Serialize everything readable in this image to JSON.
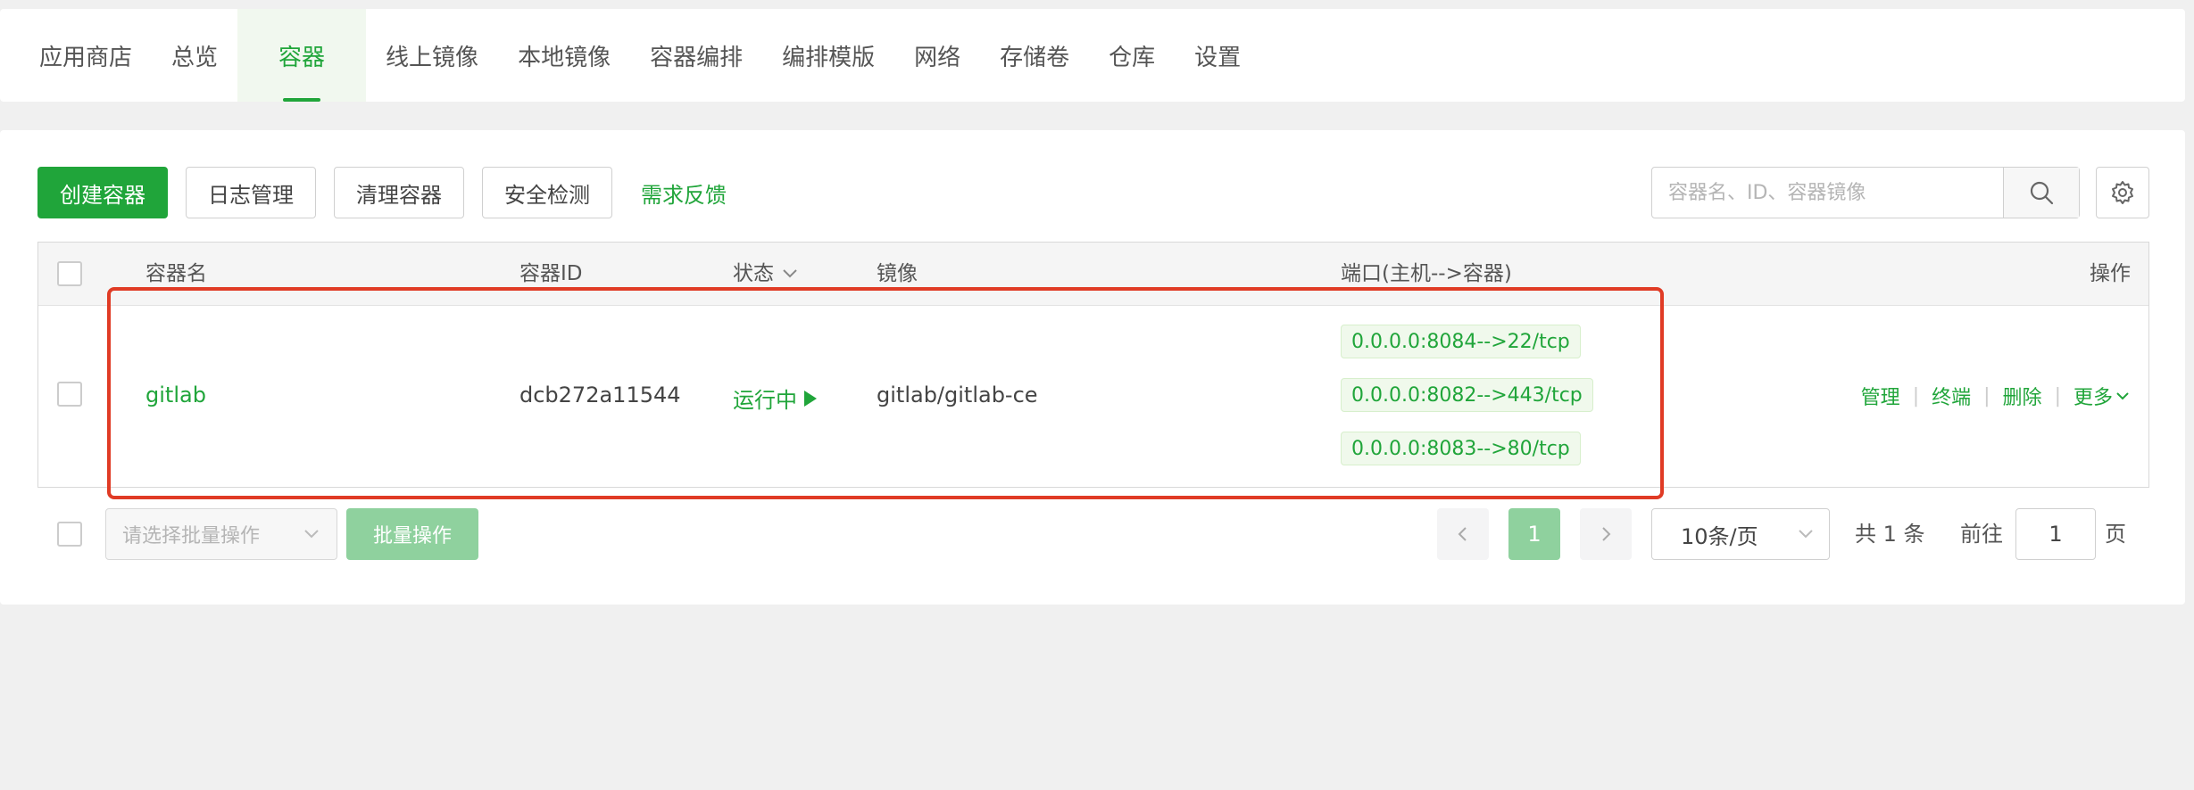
{
  "nav": {
    "tabs": [
      {
        "label": "应用商店"
      },
      {
        "label": "总览"
      },
      {
        "label": "容器",
        "active": true
      },
      {
        "label": "线上镜像"
      },
      {
        "label": "本地镜像"
      },
      {
        "label": "容器编排"
      },
      {
        "label": "编排模版"
      },
      {
        "label": "网络"
      },
      {
        "label": "存储卷"
      },
      {
        "label": "仓库"
      },
      {
        "label": "设置"
      }
    ]
  },
  "toolbar": {
    "create_label": "创建容器",
    "log_label": "日志管理",
    "clean_label": "清理容器",
    "security_label": "安全检测",
    "feedback_label": "需求反馈"
  },
  "search": {
    "placeholder": "容器名、ID、容器镜像"
  },
  "table": {
    "headers": {
      "name": "容器名",
      "id": "容器ID",
      "status": "状态",
      "image": "镜像",
      "ports": "端口(主机-->容器)",
      "ops": "操作"
    },
    "rows": [
      {
        "name": "gitlab",
        "id": "dcb272a11544",
        "status": "运行中",
        "image": "gitlab/gitlab-ce",
        "ports": [
          "0.0.0.0:8084-->22/tcp",
          "0.0.0.0:8082-->443/tcp",
          "0.0.0.0:8083-->80/tcp"
        ],
        "ops": {
          "manage": "管理",
          "terminal": "终端",
          "delete": "删除",
          "more": "更多"
        }
      }
    ]
  },
  "footer": {
    "batch_placeholder": "请选择批量操作",
    "batch_label": "批量操作",
    "current_page": "1",
    "page_size": "10条/页",
    "total": "共 1 条",
    "goto_label": "前往",
    "goto_value": "1",
    "page_unit": "页"
  },
  "colors": {
    "accent": "#20a53a",
    "highlight": "#e03b25"
  }
}
